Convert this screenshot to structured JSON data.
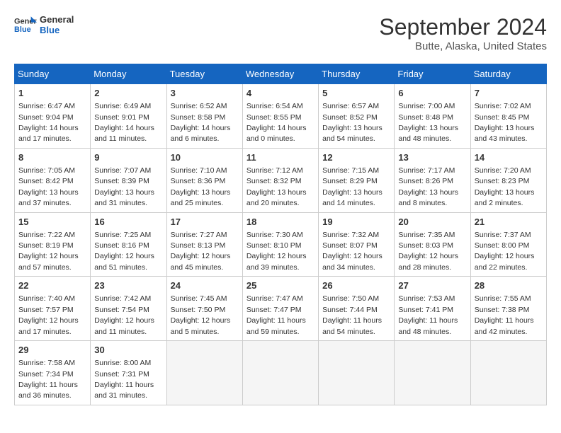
{
  "logo": {
    "text_general": "General",
    "text_blue": "Blue"
  },
  "header": {
    "month": "September 2024",
    "location": "Butte, Alaska, United States"
  },
  "days_of_week": [
    "Sunday",
    "Monday",
    "Tuesday",
    "Wednesday",
    "Thursday",
    "Friday",
    "Saturday"
  ],
  "weeks": [
    [
      {
        "day": "1",
        "sunrise": "6:47 AM",
        "sunset": "9:04 PM",
        "daylight": "14 hours and 17 minutes."
      },
      {
        "day": "2",
        "sunrise": "6:49 AM",
        "sunset": "9:01 PM",
        "daylight": "14 hours and 11 minutes."
      },
      {
        "day": "3",
        "sunrise": "6:52 AM",
        "sunset": "8:58 PM",
        "daylight": "14 hours and 6 minutes."
      },
      {
        "day": "4",
        "sunrise": "6:54 AM",
        "sunset": "8:55 PM",
        "daylight": "14 hours and 0 minutes."
      },
      {
        "day": "5",
        "sunrise": "6:57 AM",
        "sunset": "8:52 PM",
        "daylight": "13 hours and 54 minutes."
      },
      {
        "day": "6",
        "sunrise": "7:00 AM",
        "sunset": "8:48 PM",
        "daylight": "13 hours and 48 minutes."
      },
      {
        "day": "7",
        "sunrise": "7:02 AM",
        "sunset": "8:45 PM",
        "daylight": "13 hours and 43 minutes."
      }
    ],
    [
      {
        "day": "8",
        "sunrise": "7:05 AM",
        "sunset": "8:42 PM",
        "daylight": "13 hours and 37 minutes."
      },
      {
        "day": "9",
        "sunrise": "7:07 AM",
        "sunset": "8:39 PM",
        "daylight": "13 hours and 31 minutes."
      },
      {
        "day": "10",
        "sunrise": "7:10 AM",
        "sunset": "8:36 PM",
        "daylight": "13 hours and 25 minutes."
      },
      {
        "day": "11",
        "sunrise": "7:12 AM",
        "sunset": "8:32 PM",
        "daylight": "13 hours and 20 minutes."
      },
      {
        "day": "12",
        "sunrise": "7:15 AM",
        "sunset": "8:29 PM",
        "daylight": "13 hours and 14 minutes."
      },
      {
        "day": "13",
        "sunrise": "7:17 AM",
        "sunset": "8:26 PM",
        "daylight": "13 hours and 8 minutes."
      },
      {
        "day": "14",
        "sunrise": "7:20 AM",
        "sunset": "8:23 PM",
        "daylight": "13 hours and 2 minutes."
      }
    ],
    [
      {
        "day": "15",
        "sunrise": "7:22 AM",
        "sunset": "8:19 PM",
        "daylight": "12 hours and 57 minutes."
      },
      {
        "day": "16",
        "sunrise": "7:25 AM",
        "sunset": "8:16 PM",
        "daylight": "12 hours and 51 minutes."
      },
      {
        "day": "17",
        "sunrise": "7:27 AM",
        "sunset": "8:13 PM",
        "daylight": "12 hours and 45 minutes."
      },
      {
        "day": "18",
        "sunrise": "7:30 AM",
        "sunset": "8:10 PM",
        "daylight": "12 hours and 39 minutes."
      },
      {
        "day": "19",
        "sunrise": "7:32 AM",
        "sunset": "8:07 PM",
        "daylight": "12 hours and 34 minutes."
      },
      {
        "day": "20",
        "sunrise": "7:35 AM",
        "sunset": "8:03 PM",
        "daylight": "12 hours and 28 minutes."
      },
      {
        "day": "21",
        "sunrise": "7:37 AM",
        "sunset": "8:00 PM",
        "daylight": "12 hours and 22 minutes."
      }
    ],
    [
      {
        "day": "22",
        "sunrise": "7:40 AM",
        "sunset": "7:57 PM",
        "daylight": "12 hours and 17 minutes."
      },
      {
        "day": "23",
        "sunrise": "7:42 AM",
        "sunset": "7:54 PM",
        "daylight": "12 hours and 11 minutes."
      },
      {
        "day": "24",
        "sunrise": "7:45 AM",
        "sunset": "7:50 PM",
        "daylight": "12 hours and 5 minutes."
      },
      {
        "day": "25",
        "sunrise": "7:47 AM",
        "sunset": "7:47 PM",
        "daylight": "11 hours and 59 minutes."
      },
      {
        "day": "26",
        "sunrise": "7:50 AM",
        "sunset": "7:44 PM",
        "daylight": "11 hours and 54 minutes."
      },
      {
        "day": "27",
        "sunrise": "7:53 AM",
        "sunset": "7:41 PM",
        "daylight": "11 hours and 48 minutes."
      },
      {
        "day": "28",
        "sunrise": "7:55 AM",
        "sunset": "7:38 PM",
        "daylight": "11 hours and 42 minutes."
      }
    ],
    [
      {
        "day": "29",
        "sunrise": "7:58 AM",
        "sunset": "7:34 PM",
        "daylight": "11 hours and 36 minutes."
      },
      {
        "day": "30",
        "sunrise": "8:00 AM",
        "sunset": "7:31 PM",
        "daylight": "11 hours and 31 minutes."
      },
      null,
      null,
      null,
      null,
      null
    ]
  ]
}
